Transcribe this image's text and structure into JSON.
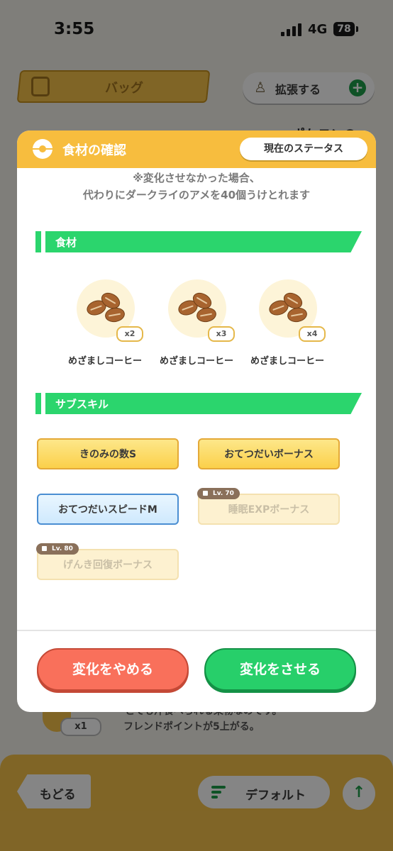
{
  "status_bar": {
    "time": "3:55",
    "network": "4G",
    "battery": "78"
  },
  "background": {
    "bag_tab_label": "バッグ",
    "expand_button_label": "拡張する",
    "side_heading": "ポケモンの",
    "item_count": "x1",
    "desc_line1": "とても汁食べられる果物なのです。",
    "desc_line2": "フレンドポイントが5上がる。",
    "back_button_label": "もどる",
    "sort_button_label": "デフォルト"
  },
  "modal": {
    "title": "食材の確認",
    "status_button_label": "現在のステータス",
    "notice_line1": "※変化させなかった場合、",
    "notice_line2": "代わりにダークライのアメを40個うけとれます",
    "ingredients_heading": "食材",
    "ingredients": [
      {
        "name": "めざましコーヒー",
        "qty": "x2",
        "icon": "coffee-bean-icon"
      },
      {
        "name": "めざましコーヒー",
        "qty": "x3",
        "icon": "coffee-bean-icon"
      },
      {
        "name": "めざましコーヒー",
        "qty": "x4",
        "icon": "coffee-bean-icon"
      }
    ],
    "subskills_heading": "サブスキル",
    "subskills": [
      {
        "label": "きのみの数S",
        "state": "gold"
      },
      {
        "label": "おてつだいボーナス",
        "state": "gold"
      },
      {
        "label": "おてつだいスピードM",
        "state": "blue"
      },
      {
        "label": "睡眠EXPボーナス",
        "state": "locked",
        "lock_level": "Lv. 70"
      },
      {
        "label": "げんき回復ボーナス",
        "state": "locked",
        "lock_level": "Lv. 80"
      }
    ],
    "cancel_button_label": "変化をやめる",
    "confirm_button_label": "変化をさせる"
  },
  "colors": {
    "header": "#f7bd3e",
    "section_green": "#2bd56d",
    "cancel_red": "#f9705b",
    "confirm_green": "#27cf6a"
  }
}
